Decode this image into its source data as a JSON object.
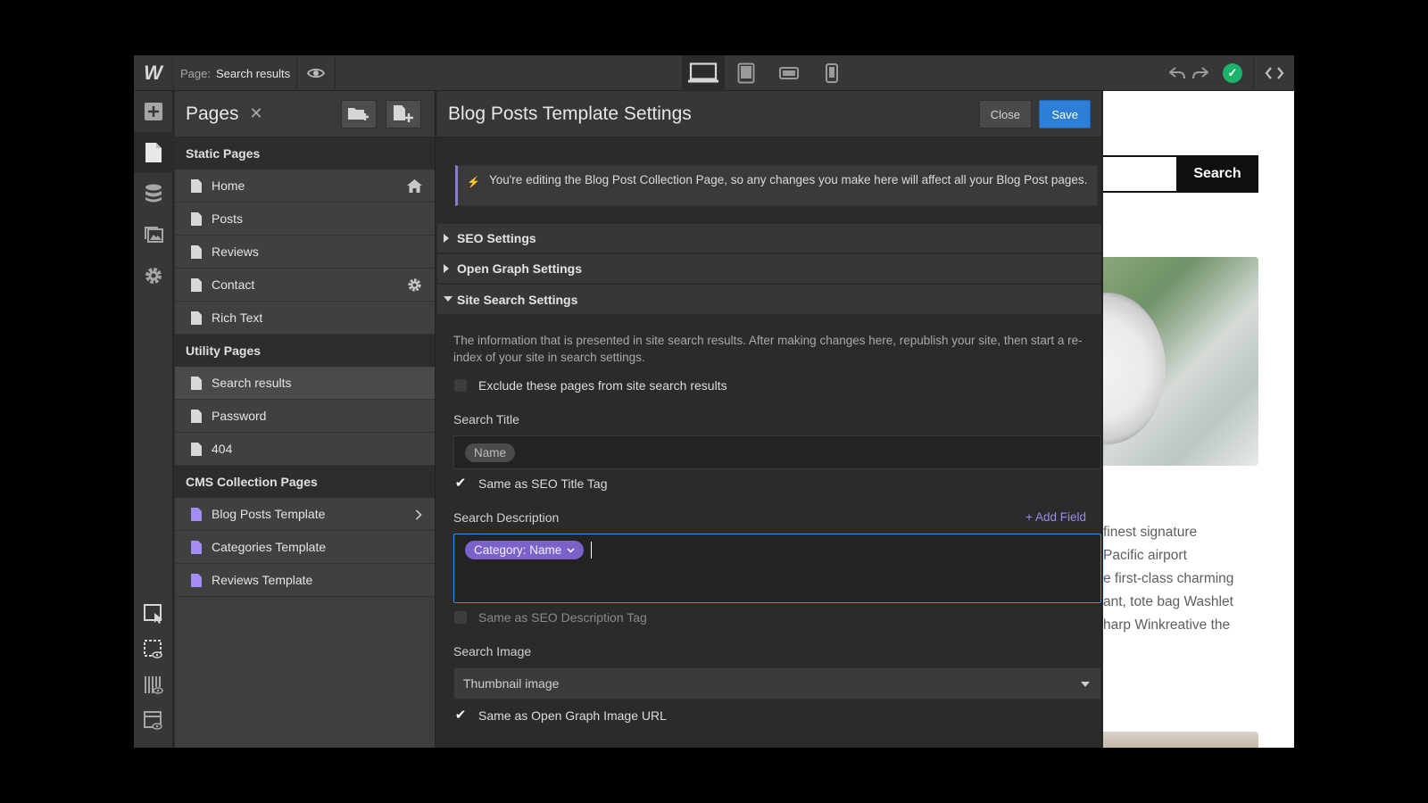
{
  "topbar": {
    "logo": "W",
    "page_label": "Page:",
    "page_name": "Search results",
    "devices": [
      "desktop-icon",
      "tablet-icon",
      "mobile-landscape-icon",
      "mobile-portrait-icon"
    ],
    "active_device": "desktop-icon"
  },
  "pages_panel": {
    "title": "Pages",
    "close": "✕",
    "sections": [
      {
        "title": "Static Pages",
        "items": [
          {
            "label": "Home",
            "icon": "home-icon"
          },
          {
            "label": "Posts"
          },
          {
            "label": "Reviews"
          },
          {
            "label": "Contact",
            "icon": "gear-icon"
          },
          {
            "label": "Rich Text"
          }
        ]
      },
      {
        "title": "Utility Pages",
        "items": [
          {
            "label": "Search results",
            "selected": true
          },
          {
            "label": "Password"
          },
          {
            "label": "404"
          }
        ]
      },
      {
        "title": "CMS Collection Pages",
        "items": [
          {
            "label": "Blog Posts Template",
            "icon": "chevron-right-icon"
          },
          {
            "label": "Categories Template"
          },
          {
            "label": "Reviews Template"
          }
        ]
      }
    ]
  },
  "settings": {
    "title": "Blog Posts Template Settings",
    "close_label": "Close",
    "save_label": "Save",
    "notice": "You're editing the Blog Post Collection Page, so any changes you make here will affect all your Blog Post pages.",
    "accordions": {
      "seo": "SEO Settings",
      "og": "Open Graph Settings",
      "site_search": "Site Search Settings"
    },
    "site_search": {
      "description": "The information that is presented in site search results. After making changes here, republish your site, then start a re-index of your site in search settings.",
      "exclude_label": "Exclude these pages from site search results",
      "exclude_checked": false,
      "search_title_label": "Search Title",
      "search_title_token": "Name",
      "same_seo_title_label": "Same as SEO Title Tag",
      "same_seo_title_checked": true,
      "search_description_label": "Search Description",
      "add_field": "+ Add Field",
      "search_description_token": "Category: Name",
      "same_seo_desc_label": "Same as SEO Description Tag",
      "same_seo_desc_checked": false,
      "search_image_label": "Search Image",
      "search_image_value": "Thumbnail image",
      "same_og_label": "Same as Open Graph Image URL",
      "same_og_checked": true
    }
  },
  "canvas": {
    "search_button": "Search",
    "body_lines": [
      "finest signature",
      "Pacific airport",
      "e first-class charming",
      "ant, tote bag Washlet",
      "harp Winkreative the"
    ]
  },
  "colors": {
    "accent_blue": "#2c7ed6",
    "accent_purple": "#7b62c9",
    "status_green": "#1db36a"
  }
}
